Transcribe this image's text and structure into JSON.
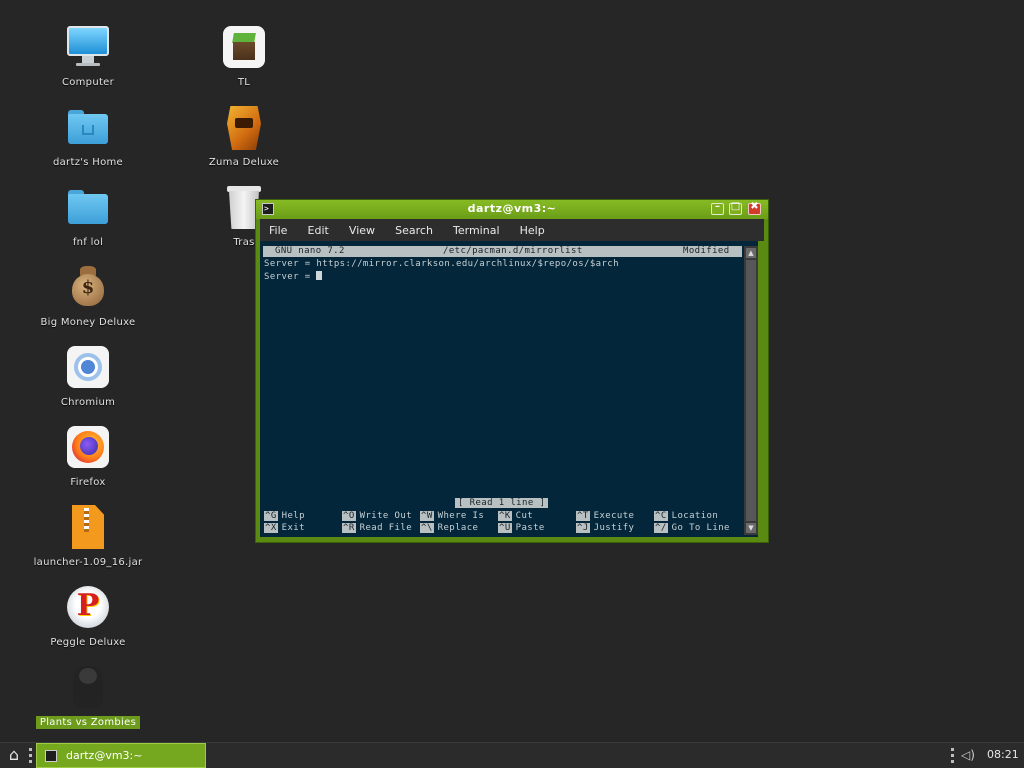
{
  "desktop": {
    "icons": [
      {
        "label": "Computer"
      },
      {
        "label": "dartz's Home"
      },
      {
        "label": "fnf lol"
      },
      {
        "label": "Big Money Deluxe"
      },
      {
        "label": "Chromium"
      },
      {
        "label": "Firefox"
      },
      {
        "label": "launcher-1.09_16.jar"
      },
      {
        "label": "Peggle Deluxe"
      },
      {
        "label": "Plants vs Zombies"
      },
      {
        "label": "TL"
      },
      {
        "label": "Zuma Deluxe"
      },
      {
        "label": "Tras"
      }
    ],
    "selected_icon": "Plants vs Zombies"
  },
  "window": {
    "title": "dartz@vm3:~",
    "controls": {
      "minimize": "–",
      "maximize": "□",
      "close": "✖"
    },
    "menu": [
      "File",
      "Edit",
      "View",
      "Search",
      "Terminal",
      "Help"
    ]
  },
  "nano": {
    "version": "GNU nano 7.2",
    "filename": "/etc/pacman.d/mirrorlist",
    "state": "Modified",
    "lines": [
      "Server = https://mirror.clarkson.edu/archlinux/$repo/os/$arch",
      "Server = "
    ],
    "status_message": "[ Read 1 line ]",
    "shortcuts": [
      {
        "key": "^G",
        "label": "Help"
      },
      {
        "key": "^X",
        "label": "Exit"
      },
      {
        "key": "^O",
        "label": "Write Out"
      },
      {
        "key": "^R",
        "label": "Read File"
      },
      {
        "key": "^W",
        "label": "Where Is"
      },
      {
        "key": "^\\",
        "label": "Replace"
      },
      {
        "key": "^K",
        "label": "Cut"
      },
      {
        "key": "^U",
        "label": "Paste"
      },
      {
        "key": "^T",
        "label": "Execute"
      },
      {
        "key": "^J",
        "label": "Justify"
      },
      {
        "key": "^C",
        "label": "Location"
      },
      {
        "key": "^/",
        "label": "Go To Line"
      }
    ]
  },
  "taskbar": {
    "start_icon": "home-arch-icon",
    "task_label": "dartz@vm3:~",
    "volume_icon": "speaker-icon",
    "clock": "08:21"
  },
  "colors": {
    "desktop": "#262626",
    "accent": "#75a81e",
    "terminal_bg": "#03263a",
    "selection": "#6d9b1c"
  }
}
